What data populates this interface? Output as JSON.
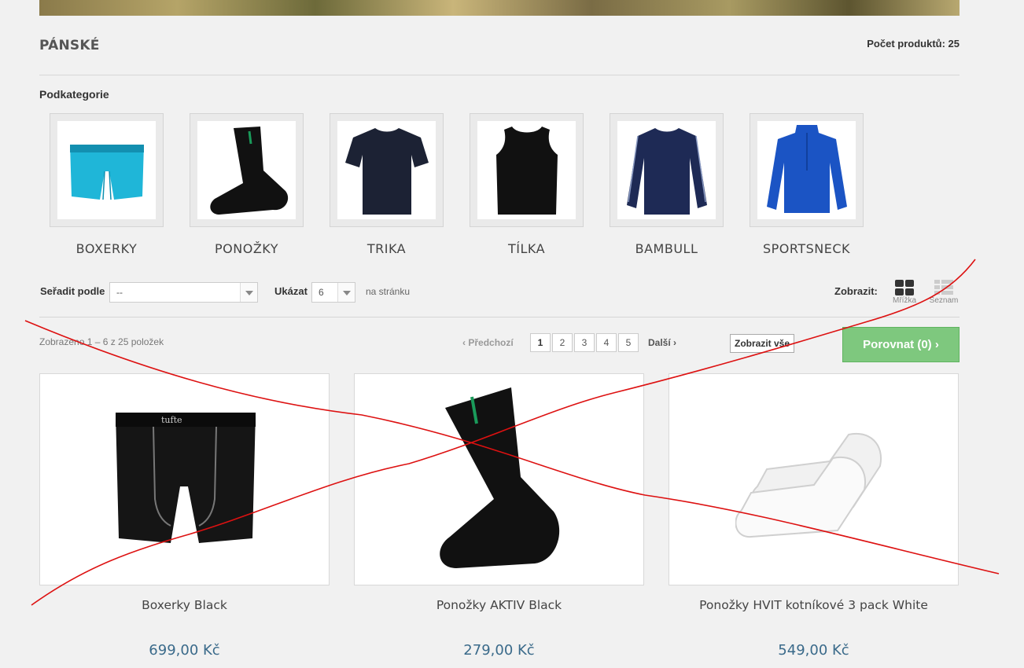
{
  "category": {
    "title": "PÁNSKÉ",
    "product_count": "Počet produktů: 25"
  },
  "subcategories": {
    "heading": "Podkategorie",
    "items": [
      {
        "label": "BOXERKY",
        "icon": "boxer-shorts-icon"
      },
      {
        "label": "PONOŽKY",
        "icon": "sock-icon"
      },
      {
        "label": "TRIKA",
        "icon": "tshirt-icon"
      },
      {
        "label": "TÍLKA",
        "icon": "tank-top-icon"
      },
      {
        "label": "BAMBULL",
        "icon": "longsleeve-icon"
      },
      {
        "label": "SPORTSNECK",
        "icon": "sport-top-icon"
      }
    ]
  },
  "toolbar": {
    "sort_label": "Seřadit podle",
    "sort_value": "--",
    "show_label": "Ukázat",
    "show_value": "6",
    "per_page_label": "na stránku",
    "view_label": "Zobrazit:",
    "grid_label": "Mřížka",
    "list_label": "Seznam"
  },
  "pagination": {
    "shown_text": "Zobrazeno 1 – 6 z 25 položek",
    "prev_label": "Předchozí",
    "pages": [
      "1",
      "2",
      "3",
      "4",
      "5"
    ],
    "active_page": "1",
    "next_label": "Další",
    "show_all_label": "Zobrazit vše",
    "compare_label": "Porovnat (0)"
  },
  "products": [
    {
      "name": "Boxerky Black",
      "price": "699,00 Kč"
    },
    {
      "name": "Ponožky AKTIV Black",
      "price": "279,00 Kč"
    },
    {
      "name": "Ponožky HVIT kotníkové 3 pack White",
      "price": "549,00 Kč"
    }
  ],
  "colors": {
    "price": "#3a6a8a",
    "compare_button": "#7ec87e",
    "scribble": "#dd1111"
  }
}
